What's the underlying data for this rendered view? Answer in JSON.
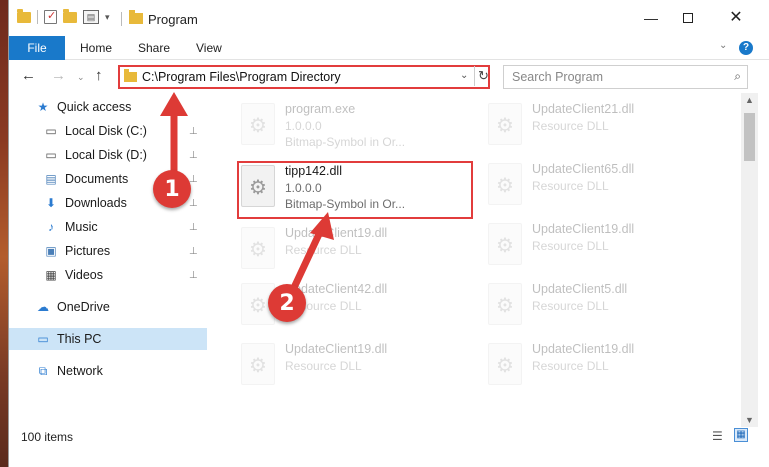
{
  "window": {
    "title": "Program",
    "buttons": {
      "minimize": "—",
      "maximize": "",
      "close": "✕"
    }
  },
  "ribbon": {
    "tabs": [
      "File",
      "Home",
      "Share",
      "View"
    ],
    "collapse_glyph": "⌄",
    "help_glyph": "?"
  },
  "nav": {
    "back_glyph": "←",
    "forward_glyph": "→",
    "recent_glyph": "⌄",
    "up_glyph": "↑",
    "address": "C:\\Program Files\\Program Directory",
    "address_dropdown_glyph": "⌄",
    "refresh_glyph": "↻",
    "search_placeholder": "Search Program",
    "search_glyph": "⌕"
  },
  "sidebar": {
    "items": [
      {
        "label": "Quick access",
        "icon": "star-icon",
        "glyph": "★",
        "color": "#2b7bd0",
        "pinned": false,
        "selected": false
      },
      {
        "label": "Local Disk (C:)",
        "icon": "drive-icon",
        "glyph": "▭",
        "color": "#555555",
        "pinned": true,
        "selected": false
      },
      {
        "label": "Local Disk (D:)",
        "icon": "drive-icon",
        "glyph": "▭",
        "color": "#555555",
        "pinned": true,
        "selected": false
      },
      {
        "label": "Documents",
        "icon": "documents-icon",
        "glyph": "▤",
        "color": "#4a7fb8",
        "pinned": true,
        "selected": false
      },
      {
        "label": "Downloads",
        "icon": "download-icon",
        "glyph": "⬇",
        "color": "#2b7bd0",
        "pinned": true,
        "selected": false
      },
      {
        "label": "Music",
        "icon": "music-icon",
        "glyph": "♪",
        "color": "#2b7bd0",
        "pinned": true,
        "selected": false
      },
      {
        "label": "Pictures",
        "icon": "pictures-icon",
        "glyph": "▣",
        "color": "#4a7fb8",
        "pinned": true,
        "selected": false
      },
      {
        "label": "Videos",
        "icon": "video-icon",
        "glyph": "▦",
        "color": "#444444",
        "pinned": true,
        "selected": false
      },
      {
        "label": "OneDrive",
        "icon": "cloud-icon",
        "glyph": "☁",
        "color": "#2b7bd0",
        "pinned": false,
        "selected": false
      },
      {
        "label": "This PC",
        "icon": "computer-icon",
        "glyph": "▭",
        "color": "#2b7bd0",
        "pinned": false,
        "selected": true
      },
      {
        "label": "Network",
        "icon": "network-icon",
        "glyph": "⧉",
        "color": "#2b7bd0",
        "pinned": false,
        "selected": false
      }
    ],
    "pin_glyph": "📌"
  },
  "files": {
    "program": {
      "name": "program.exe",
      "line2": "1.0.0.0",
      "line3": "Bitmap-Symbol in Or..."
    },
    "target": {
      "name": "tipp142.dll",
      "line2": "1.0.0.0",
      "line3": "Bitmap-Symbol in Or..."
    },
    "col1": [
      {
        "name": "UpdateClient19.dll",
        "line2": "Resource DLL"
      },
      {
        "name": "UpdateClient42.dll",
        "line2": "Resource DLL"
      },
      {
        "name": "UpdateClient19.dll",
        "line2": "Resource DLL"
      }
    ],
    "col2": [
      {
        "name": "UpdateClient21.dll",
        "line2": "Resource DLL"
      },
      {
        "name": "UpdateClient65.dll",
        "line2": "Resource DLL"
      },
      {
        "name": "UpdateClient19.dll",
        "line2": "Resource DLL"
      },
      {
        "name": "UpdateClient5.dll",
        "line2": "Resource DLL"
      },
      {
        "name": "UpdateClient19.dll",
        "line2": "Resource DLL"
      }
    ]
  },
  "status": {
    "item_count": "100 items",
    "details_view_glyph": "☰",
    "tiles_view_glyph": "▦"
  },
  "annotations": {
    "step1": "1",
    "step2": "2",
    "color": "#dd3a35"
  }
}
